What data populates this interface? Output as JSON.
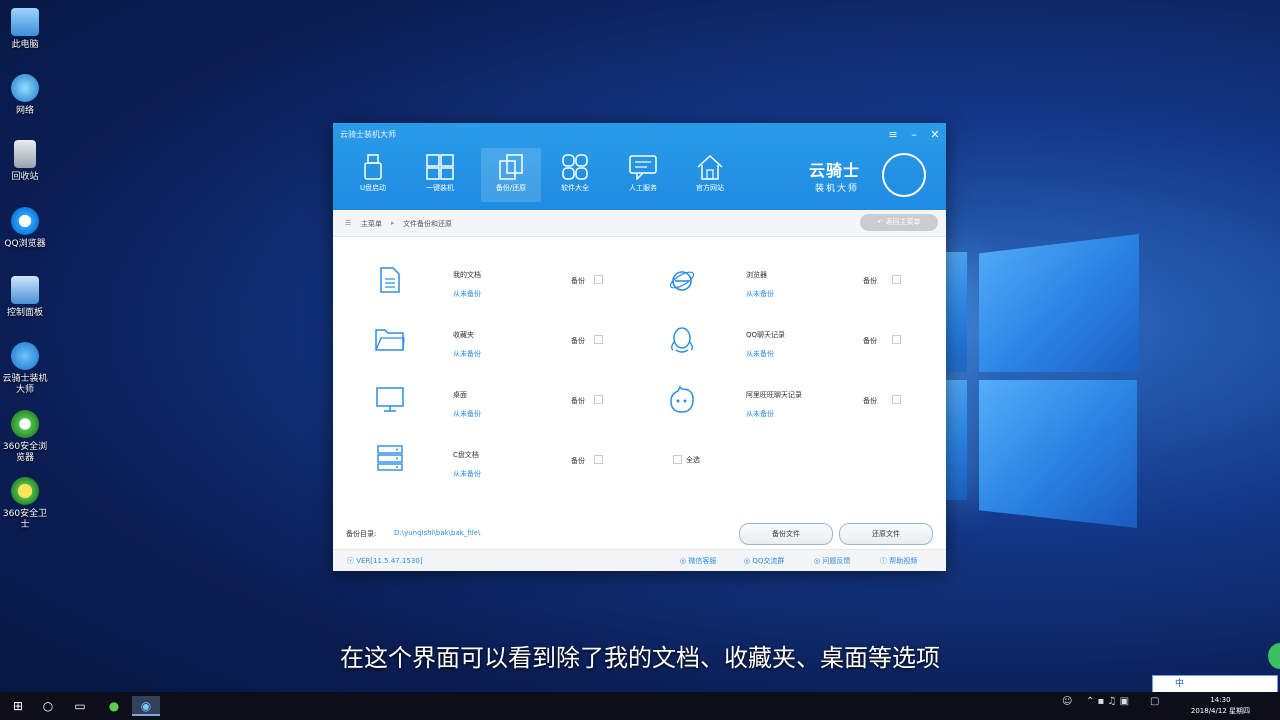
{
  "desktop": {
    "icons": [
      {
        "label": "此电脑",
        "icon": "computer-icon"
      },
      {
        "label": "网络",
        "icon": "network-icon"
      },
      {
        "label": "回收站",
        "icon": "recycle-bin-icon"
      },
      {
        "label": "QQ浏览器",
        "icon": "qq-browser-icon"
      },
      {
        "label": "控制面板",
        "icon": "control-panel-icon"
      },
      {
        "label": "云骑士装机大师",
        "icon": "yunqishi-icon"
      },
      {
        "label": "360安全浏览器",
        "icon": "360-browser-icon"
      },
      {
        "label": "360安全卫士",
        "icon": "360-guard-icon"
      }
    ]
  },
  "app": {
    "title": "云骑士装机大师",
    "nav": [
      {
        "label": "U盘启动"
      },
      {
        "label": "一键装机"
      },
      {
        "label": "备份/还原"
      },
      {
        "label": "软件大全"
      },
      {
        "label": "人工服务"
      },
      {
        "label": "官方网站"
      }
    ],
    "brand": {
      "line1": "云骑士",
      "line2": "装机大师"
    },
    "breadcrumb": {
      "home": "主菜单",
      "current": "文件备份和还原"
    },
    "back_button": "返回主菜单",
    "items": [
      {
        "name": "我的文档",
        "link": "从未备份",
        "backup_label": "备份",
        "icon": "document-icon"
      },
      {
        "name": "浏览器",
        "link": "从未备份",
        "backup_label": "备份",
        "icon": "ie-icon"
      },
      {
        "name": "收藏夹",
        "link": "从未备份",
        "backup_label": "备份",
        "icon": "folder-icon"
      },
      {
        "name": "QQ聊天记录",
        "link": "从未备份",
        "backup_label": "备份",
        "icon": "qq-icon"
      },
      {
        "name": "桌面",
        "link": "从未备份",
        "backup_label": "备份",
        "icon": "monitor-icon"
      },
      {
        "name": "阿里旺旺聊天记录",
        "link": "从未备份",
        "backup_label": "备份",
        "icon": "wangwang-icon"
      },
      {
        "name": "C盘文档",
        "link": "从未备份",
        "backup_label": "备份",
        "icon": "drive-icon"
      }
    ],
    "select_all": "全选",
    "backup_dir_label": "备份目录:",
    "backup_dir_value": "D:\\yunqishi\\bak\\bak_file\\",
    "backup_button": "备份文件",
    "restore_button": "还原文件",
    "version": "VER[11.5.47.1530]",
    "footer_links": [
      "微信客服",
      "QQ交流群",
      "问题反馈",
      "帮助视频"
    ]
  },
  "caption": "在这个界面可以看到除了我的文档、收藏夹、桌面等选项",
  "taskbar": {
    "clock_time": "14:30",
    "clock_date": "2018/4/12 星期四",
    "ime": "中"
  }
}
